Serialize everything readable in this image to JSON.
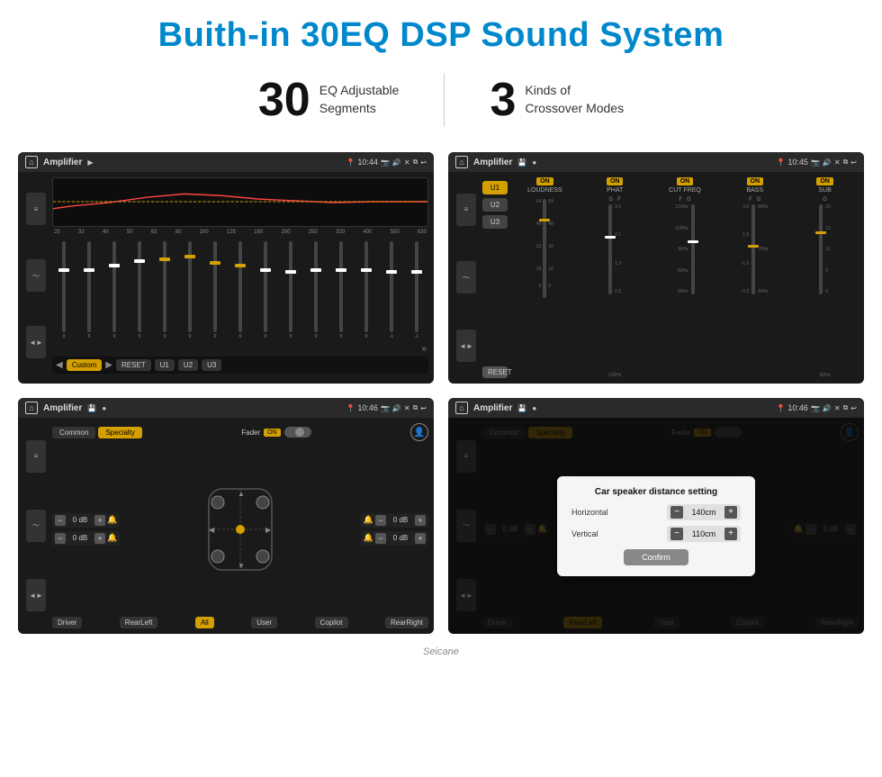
{
  "header": {
    "title": "Buith-in 30EQ DSP Sound System"
  },
  "stats": [
    {
      "number": "30",
      "desc_line1": "EQ Adjustable",
      "desc_line2": "Segments"
    },
    {
      "number": "3",
      "desc_line1": "Kinds of",
      "desc_line2": "Crossover Modes"
    }
  ],
  "screenshots": [
    {
      "id": "screen1",
      "statusbar": {
        "app": "Amplifier",
        "time": "10:44"
      },
      "type": "eq",
      "frequencies": [
        "25",
        "32",
        "40",
        "50",
        "63",
        "80",
        "100",
        "125",
        "160",
        "200",
        "250",
        "320",
        "400",
        "500",
        "630"
      ],
      "bottomBtns": [
        "Custom",
        "RESET",
        "U1",
        "U2",
        "U3"
      ]
    },
    {
      "id": "screen2",
      "statusbar": {
        "app": "Amplifier",
        "time": "10:45"
      },
      "type": "crossover",
      "presets": [
        "U1",
        "U2",
        "U3"
      ],
      "channels": [
        "LOUDNESS",
        "PHAT",
        "CUT FREQ",
        "BASS",
        "SUB"
      ],
      "resetBtn": "RESET"
    },
    {
      "id": "screen3",
      "statusbar": {
        "app": "Amplifier",
        "time": "10:46"
      },
      "type": "fader",
      "tabs": [
        "Common",
        "Specialty"
      ],
      "activeTab": "Specialty",
      "faderLabel": "Fader",
      "faderOn": "ON",
      "dbValues": [
        "0 dB",
        "0 dB",
        "0 dB",
        "0 dB"
      ],
      "speakerBtns": [
        "Driver",
        "RearLeft",
        "All",
        "User",
        "Copilot",
        "RearRight"
      ]
    },
    {
      "id": "screen4",
      "statusbar": {
        "app": "Amplifier",
        "time": "10:46"
      },
      "type": "fader-dialog",
      "tabs": [
        "Common",
        "Specialty"
      ],
      "activeTab": "Specialty",
      "dialog": {
        "title": "Car speaker distance setting",
        "rows": [
          {
            "label": "Horizontal",
            "value": "140cm"
          },
          {
            "label": "Vertical",
            "value": "110cm"
          }
        ],
        "confirmBtn": "Confirm"
      },
      "dbValues": [
        "0 dB",
        "0 dB"
      ],
      "speakerBtns": [
        "Driver",
        "RearLeft",
        "User",
        "Copilot",
        "RearRight"
      ]
    }
  ],
  "watermark": "Seicane",
  "icons": {
    "home": "⌂",
    "back": "↩",
    "play": "▶",
    "prev": "◀",
    "settings": "⚙",
    "camera": "📷",
    "volume": "🔊",
    "close": "✕",
    "copy": "⧉",
    "minus": "−",
    "plus": "+"
  }
}
